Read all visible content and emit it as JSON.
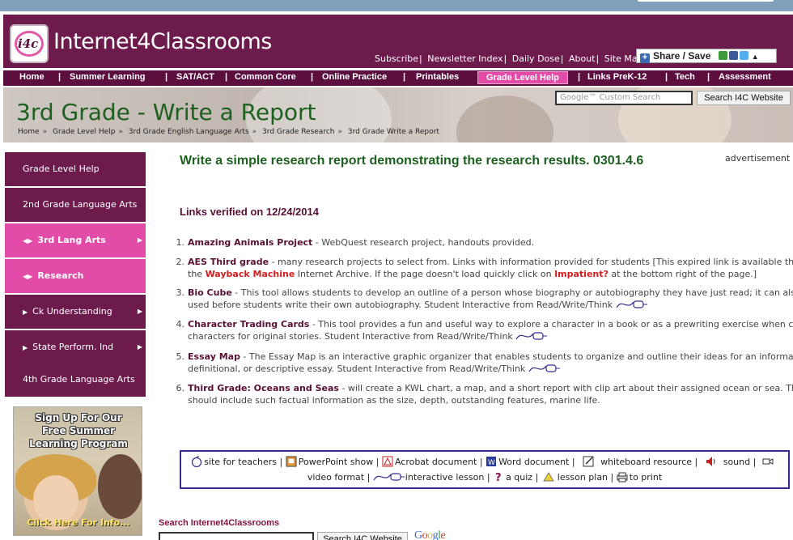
{
  "header": {
    "logo_mark": "i4c",
    "logo_text": "Internet4Classrooms",
    "links": [
      "Subscribe",
      "Newsletter Index",
      "Daily Dose",
      "About",
      "Site Map"
    ],
    "share_label": "Share / Save"
  },
  "nav": {
    "items": [
      "Home",
      "Summer Learning",
      "SAT/ACT",
      "Common Core",
      "Online Practice",
      "Printables",
      "Grade Level Help",
      "Links PreK-12",
      "Tech",
      "Assessment"
    ],
    "active": "Grade Level Help"
  },
  "banner": {
    "title_grade": "3rd Grade",
    "title_rest": " - Write a Report",
    "search_placeholder": "Google™ Custom Search",
    "search_button": "Search I4C Website",
    "breadcrumb": [
      "Home",
      "Grade Level Help",
      "3rd Grade English Language Arts",
      "3rd Grade Research",
      "3rd Grade Write a Report"
    ]
  },
  "sidebar": {
    "items": [
      {
        "label": "Grade Level Help",
        "style": "dark"
      },
      {
        "label": "2nd Grade Language Arts",
        "style": "dark"
      },
      {
        "label": "3rd Lang Arts",
        "style": "pink"
      },
      {
        "label": "Research",
        "style": "pink"
      },
      {
        "label": "Ck Understanding",
        "style": "dark"
      },
      {
        "label": "State Perform. Ind",
        "style": "dark"
      },
      {
        "label": "4th Grade Language Arts",
        "style": "dark"
      }
    ],
    "promo": {
      "line1": "Sign Up For Our",
      "line2": "Free Summer",
      "line3": "Learning Program",
      "cta": "Click Here For Info..."
    }
  },
  "main": {
    "title": "Write a simple research report demonstrating the research results. 0301.4.6",
    "advertisement": "advertisement",
    "verified": "Links verified on 12/24/2014",
    "items": [
      {
        "num": "1.",
        "title": "Amazing Animals Project",
        "line1": " - WebQuest research project, handouts provided.",
        "line2": ""
      },
      {
        "num": "2.",
        "title": "AES Third grade",
        "line1": " - many research projects to select from. Links with information provided for students [This expired link is available through",
        "line2_pre": "the ",
        "line2_red": "Wayback Machine",
        "line2_mid": " Internet Archive. If the page doesn't load quickly click on ",
        "line2_red2": "Impatient?",
        "line2_post": " at the bottom right of the page.]"
      },
      {
        "num": "3.",
        "title": "Bio Cube",
        "line1": " - This tool allows students to develop an outline of a person whose biography or autobiography they have just read; it can also be",
        "line2": "used before students write their own autobiography. Student Interactive from Read/Write/Think"
      },
      {
        "num": "4.",
        "title": "Character Trading Cards",
        "line1": " - This tool provides a fun and useful way to explore a character in a book or as a prewriting exercise when creating",
        "line2": "characters for original stories. Student Interactive from Read/Write/Think"
      },
      {
        "num": "5.",
        "title": "Essay Map",
        "line1": " - The Essay Map is an interactive graphic organizer that enables students to organize and outline their ideas for an informational,",
        "line2": "definitional, or descriptive essay. Student Interactive from Read/Write/Think"
      },
      {
        "num": "6.",
        "title": "Third Grade: Oceans and Seas",
        "line1": " - will create a KWL chart, a map, and a short report with clip art about their assigned ocean or sea. The report",
        "line2": "should include such factual information as the size, depth, outstanding features, marine life."
      }
    ]
  },
  "legend": {
    "items": [
      "site for teachers",
      "PowerPoint show",
      "Acrobat document",
      "Word document",
      "whiteboard resource",
      "sound",
      "video format",
      "interactive lesson",
      "a quiz",
      "lesson plan",
      "to print"
    ]
  },
  "bottom_search": {
    "label": "Search Internet4Classrooms",
    "button": "Search I4C Website",
    "google": "Google"
  },
  "colors": {
    "maroon": "#6d1a4c",
    "pink": "#e24ca8",
    "green_title": "#1e6020",
    "legend_border": "#3a2b8c"
  }
}
